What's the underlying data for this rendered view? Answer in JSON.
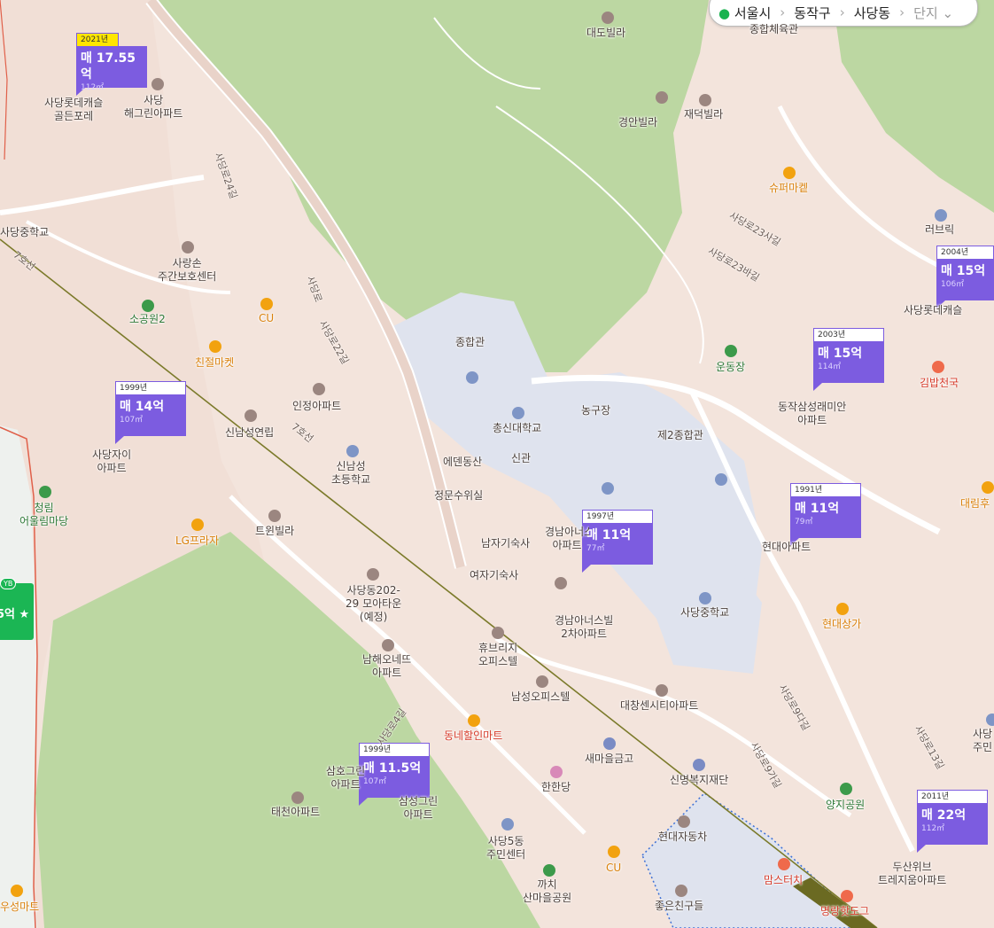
{
  "region_bar": {
    "city": "서울시",
    "district": "동작구",
    "dong": "사당동",
    "complex_placeholder": "단지",
    "pin_icon": "location-pin-icon",
    "dropdown_icon": "chevron-down-icon"
  },
  "listings": [
    {
      "year": "2021년",
      "price": "매 17.55억",
      "area": "112㎡"
    },
    {
      "year": "1999년",
      "price": "매 14억",
      "area": "107㎡"
    },
    {
      "year": "1997년",
      "price": "매 11억",
      "area": "77㎡"
    },
    {
      "year": "1999년",
      "price": "매 11.5억",
      "area": "107㎡"
    },
    {
      "year": "2003년",
      "price": "매 15억",
      "area": "114㎡"
    },
    {
      "year": "1991년",
      "price": "매 11억",
      "area": "79㎡"
    },
    {
      "year": "2004년",
      "price": "매 15억",
      "area": "106㎡"
    },
    {
      "year": "2011년",
      "price": "매 22억",
      "area": "112㎡"
    }
  ],
  "partial_card": {
    "price": "5억 ★",
    "badge": "YB"
  },
  "subway_line": "7호선",
  "places": {
    "sadang_lotte": "사당롯데캐슬\n골든포레",
    "haegreen": "사당\n해그린아파트",
    "sadang_cheong": "사당중학교",
    "sarangson": "사랑손\n주간보호센터",
    "sogongwon2": "소공원2",
    "cu1": "CU",
    "chinjeol": "친절마켓",
    "injeong": "인정아파트",
    "sinnamseong_yeonrip": "신남성연립",
    "sadang_jai": "사당자이\n아파트",
    "cheongrim": "청림\n어울림마당",
    "lg": "LG프라자",
    "sinnamseong_school": "신남성\n초등학교",
    "twin": "트윈빌라",
    "moa": "사당동202-\n29 모아타운\n(예정)",
    "namhae": "남해오네뜨\n아파트",
    "samho": "삼호그린\n아파트",
    "samho2": "삼성그린\n아파트",
    "taecheon": "태천아파트",
    "woosung": "우성마트",
    "daedo": "대도빌라",
    "jonghap_gym": "종합체육관",
    "gyeongan": "경안빌라",
    "jaedeok": "재덕빌라",
    "super": "슈퍼마켙",
    "jonghapgwan": "종합관",
    "chongshin": "총신대학교",
    "basketball": "농구장",
    "je2": "제2종합관",
    "eden": "에덴동산",
    "singwan": "신관",
    "jeongmun": "정문수위실",
    "namja": "남자기숙사",
    "yeoja": "여자기숙사",
    "gyeongnam1": "경남아너스빌\n아파트",
    "gyeongnam2": "경남아너스빌\n2차아파트",
    "hyubridge": "휴브리지\n오피스텔",
    "namseong_office": "남성오피스텔",
    "donghae": "동네할인마트",
    "saemaeul": "새마을금고",
    "hanhan": "한한당",
    "sadang5": "사당5동\n주민센터",
    "cu2": "CU",
    "kkachi": "까치\n산마을공원",
    "daechang": "대창센시티아파트",
    "sinmyeong": "신명복지재단",
    "hyundai_car": "현대자동차",
    "good_friends": "좋은친구들",
    "momstouch": "맘스터치",
    "myeongrang": "명랑핫도그",
    "sadang_middle": "사당중학교",
    "hyundai_sangga": "현대상가",
    "hyundai_apt": "현대아파트",
    "undong": "운동장",
    "dongjak_raemian": "동작삼성래미안\n아파트",
    "gimbap": "김밥천국",
    "lovebrick": "러브릭",
    "sadang_lotte2": "사당롯데캐슬",
    "daerim": "대림후",
    "yangji": "양지공원",
    "doosan": "두산위브\n트레지움아파트",
    "sadang_right": "사당\n주민"
  },
  "roads": {
    "r24": "사당로24길",
    "sadangro": "사당로",
    "r22": "사당로22길",
    "r23sa": "사당로23사길",
    "r23ba": "사당로23바길",
    "r9da": "사당로9다길",
    "r9ga": "사당로9가길",
    "r13": "사당로13길",
    "r4": "사당로4길"
  },
  "colors": {
    "card": "#7c5ce0",
    "park": "#bcd7a2",
    "campus": "#dfe3ee",
    "subway": "#7b7a2a",
    "highlight": "#ffe600"
  }
}
